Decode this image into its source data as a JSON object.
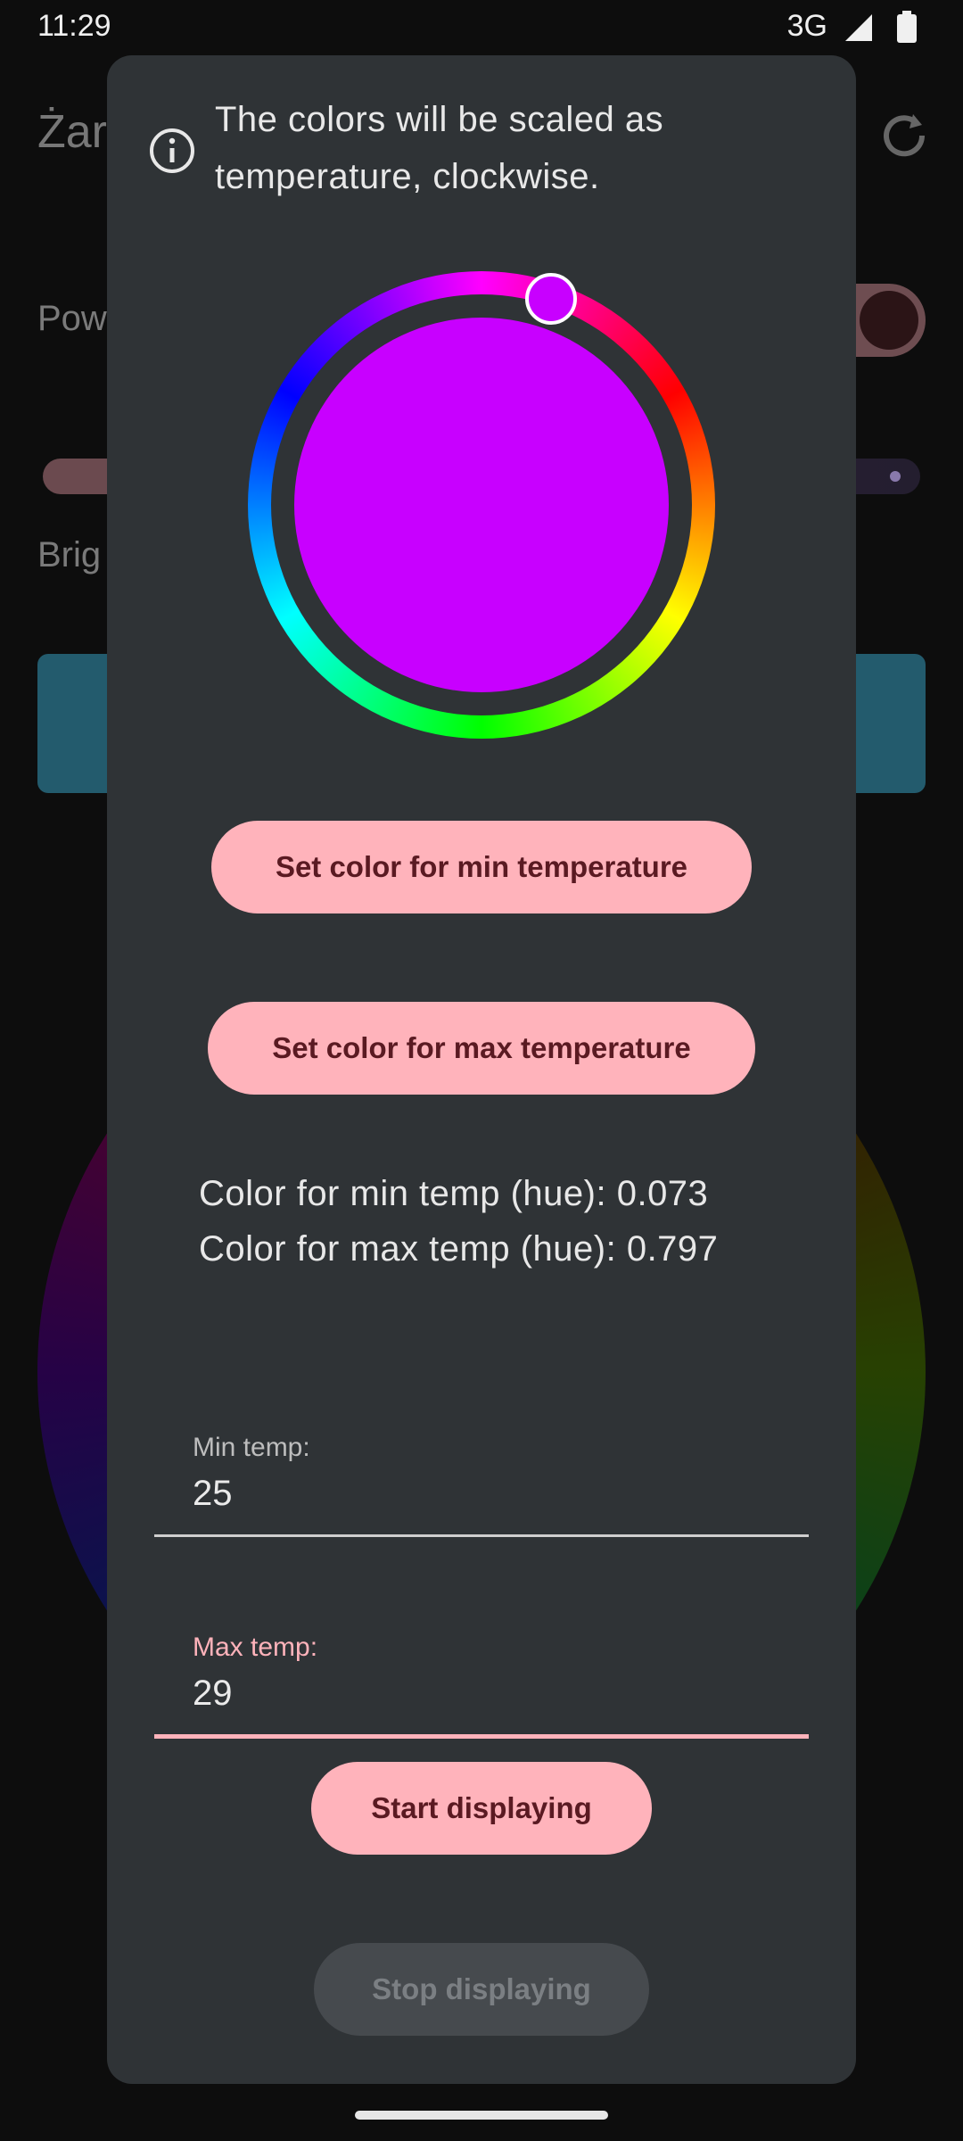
{
  "status_bar": {
    "time": "11:29",
    "network": "3G",
    "signal_icon": "cell-signal-icon",
    "battery_icon": "battery-icon"
  },
  "background_app": {
    "title": "Żar",
    "refresh_icon": "refresh-icon",
    "power_label": "Pow",
    "brightness_label": "Brig"
  },
  "dialog": {
    "info_icon": "info-icon",
    "info_text": "The colors will be scaled as temperature, clockwise.",
    "color_wheel": {
      "selected_hue_color": "#c800ff"
    },
    "buttons": {
      "set_min": "Set color for min temperature",
      "set_max": "Set color for max temperature",
      "start": "Start displaying",
      "stop": "Stop displaying"
    },
    "hue_min": "Color for min temp (hue): 0.073",
    "hue_max": "Color for max temp (hue): 0.797",
    "min_field": {
      "label": "Min temp:",
      "value": "25"
    },
    "max_field": {
      "label": "Max temp:",
      "value": "29"
    }
  },
  "colors": {
    "accent": "#ffb3bb",
    "dialog_bg": "#2f3336",
    "on_accent": "#5a1a22"
  }
}
